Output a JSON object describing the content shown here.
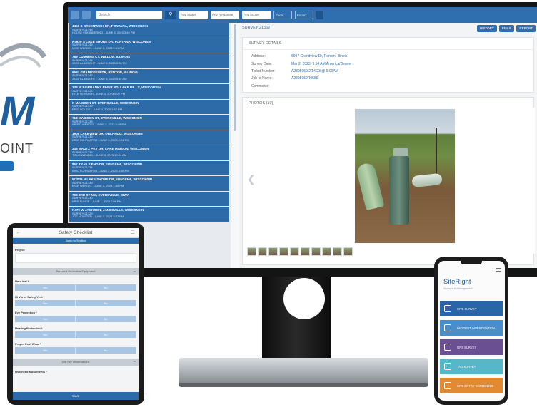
{
  "brand": {
    "logo_letter": "M",
    "logo_word": "OINT"
  },
  "desktop": {
    "toolbar": {
      "search_placeholder": "Search",
      "filters": [
        "Any Status",
        "Any Response",
        "Any Scope"
      ],
      "pills": [
        "Excel",
        "Export"
      ]
    },
    "list": [
      {
        "title": "4455 S GREENWICH DR, FONTANA, WISCONSIN",
        "line1": "SURVEY 21748",
        "line2": "HOUSE ENGINEERING - JUNE 5, 2023 3:46 PM"
      },
      {
        "title": "N4629 S LAKE SHORE DR, FONTANA, WISCONSIN",
        "line1": "SURVEY 21745",
        "line2": "MIKE WENDEL - JUNE 5, 2023 2:41 PM"
      },
      {
        "title": "789 CUMMINS CT, WILLOW, ILLINOIS",
        "line1": "SURVEY 21744",
        "line2": "JAKE ALBRECHT - JUNE 5, 2023 2:08 PM"
      },
      {
        "title": "6997 GRANDVIEW DR, RENTON, ILLINOIS",
        "line1": "SURVEY 21742",
        "line2": "JAKE ALBRECHT - JUNE 5, 2023 9:14 AM"
      },
      {
        "title": "233 W FAIRBANKS RIVER RD, LAKE MILLS, WISCONSIN",
        "line1": "SURVEY 21740",
        "line2": "LYLE TERRASH - JUNE 4, 2023 5:02 PM"
      },
      {
        "title": "N MADISON CT, EVERSVILLE, WISCONSIN",
        "line1": "SURVEY 21739",
        "line2": "ERIC HOLIDE - JUNE 4, 2023 1:57 PM"
      },
      {
        "title": "718 MADISON CT, EVERSVILLE, WISCONSIN",
        "line1": "SURVEY 21738",
        "line2": "KRISTI WENDEL - JUNE 3, 2023 3:48 PM"
      },
      {
        "title": "1905 LAKEVIEW DR, ORLANDO, WISCONSIN",
        "line1": "SURVEY 21736",
        "line2": "ERIC SCHRAFFER - JUNE 3, 2023 2:04 PM"
      },
      {
        "title": "235 MAUTZ PKY DR, LAKE MARION, WISCONSIN",
        "line1": "SURVEY 21735",
        "line2": "TITUS WENDEL - JUNE 3, 2023 10:04 AM"
      },
      {
        "title": "852 TRAILS END DR, FONTANA, WISCONSIN",
        "line1": "SURVEY 21734",
        "line2": "ERIC SCHRAFFER - JUNE 2, 2023 4:08 PM"
      },
      {
        "title": "W2036 N LAKE SHORE DR, FONTANA, WISCONSIN",
        "line1": "SURVEY 21733",
        "line2": "MIKE WENDEL - JUNE 2, 2023 1:40 PM"
      },
      {
        "title": "798 3RD ST NW, EVERSVILLE, IOWA",
        "line1": "SURVEY 21730",
        "line2": "KRIS SUNDE - JUNE 1, 2023 7:06 PM"
      },
      {
        "title": "N470 W JACKSON, JANESVILLE, WISCONSIN",
        "line1": "SURVEY 21729",
        "line2": "JOE HOLSTEN - JUNE 1, 2023 2:27 PM"
      }
    ],
    "detail": {
      "title": "SURVEY 21562",
      "buttons": [
        "HISTORY",
        "EMAIL",
        "REPORT"
      ],
      "details_header": "SURVEY DETAILS",
      "fields": [
        {
          "k": "Address:",
          "v": "6997 Grandview Dr, Renton, Illinois"
        },
        {
          "k": "Survey Date:",
          "v": "Mar 2, 2023, 9:14 AM America/Denver"
        },
        {
          "k": "Ticket Number:",
          "v": "A2305950 2/14/23 @ 9:00AM"
        },
        {
          "k": "Job Id Name:",
          "v": "A2305950R0589"
        },
        {
          "k": "Comments:",
          "v": ""
        }
      ],
      "photos_header": "PHOTOS (10)",
      "thumb_count": 10
    }
  },
  "tablet": {
    "title": "Safety Checklist",
    "jump": "Jump to Section",
    "project_label": "Project",
    "section1": "Personal Protective Equipment",
    "questions": [
      "Hard Hat *",
      "Hi Vis or Safety Vest *",
      "Eye Protection *",
      "Hearing Protection *",
      "Proper Foot Wear *"
    ],
    "yes": "Yes",
    "no": "No",
    "section2": "Job Site Observations",
    "overhead_label": "Overhead Monuments *",
    "save": "SAVE"
  },
  "phone": {
    "brand": "SiteRight",
    "tagline": "Surveys & Management",
    "tiles": [
      {
        "label": "SITE SURVEY",
        "color": "#2866a8",
        "icon": "survey-icon"
      },
      {
        "label": "INCIDENT INVESTIGATION",
        "color": "#4a8ec9",
        "icon": "incident-icon"
      },
      {
        "label": "GPS SURVEY",
        "color": "#6b4f93",
        "icon": "gps-icon"
      },
      {
        "label": "TAG SURVEY",
        "color": "#57b6c8",
        "icon": "tag-icon"
      },
      {
        "label": "SITE ENTRY SCREENING",
        "color": "#e08a34",
        "icon": "screening-icon"
      }
    ]
  }
}
